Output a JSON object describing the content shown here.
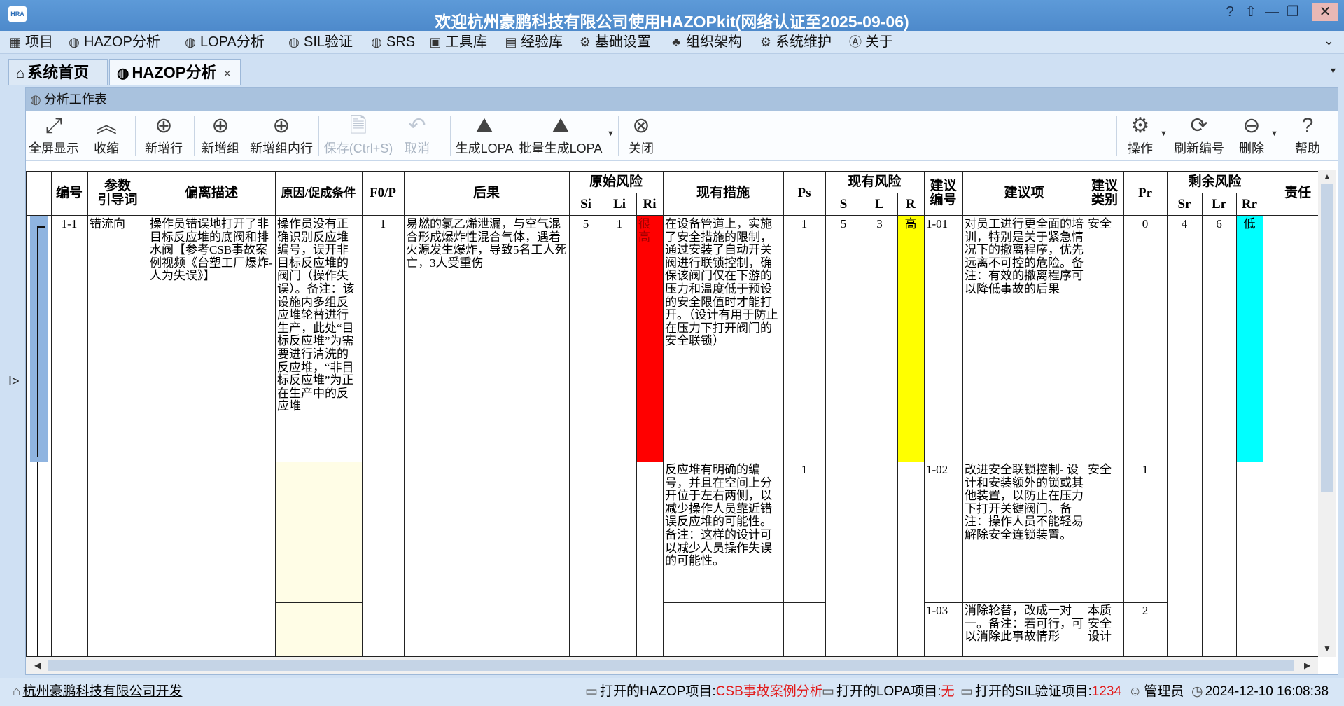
{
  "window": {
    "title": "欢迎杭州豪鹏科技有限公司使用HAZOPkit(网络认证至2025-09-06)",
    "logo_text": "HRA",
    "controls": [
      "?",
      "⇧",
      "—",
      "❐",
      "✕"
    ]
  },
  "menu": [
    {
      "icon": "grid-icon",
      "label": "项目"
    },
    {
      "icon": "hazop-icon",
      "label": "HAZOP分析"
    },
    {
      "icon": "lopa-icon",
      "label": "LOPA分析"
    },
    {
      "icon": "sil-icon",
      "label": "SIL验证"
    },
    {
      "icon": "srs-icon",
      "label": "SRS"
    },
    {
      "icon": "toolbox-icon",
      "label": "工具库"
    },
    {
      "icon": "library-icon",
      "label": "经验库"
    },
    {
      "icon": "gear-icon",
      "label": "基础设置"
    },
    {
      "icon": "org-icon",
      "label": "组织架构"
    },
    {
      "icon": "maintenance-icon",
      "label": "系统维护"
    },
    {
      "icon": "about-icon",
      "label": "关于"
    }
  ],
  "tabs": [
    {
      "label": "系统首页",
      "active": false
    },
    {
      "label": "HAZOP分析",
      "active": true,
      "close": "×"
    }
  ],
  "panel": {
    "title": "分析工作表"
  },
  "toolbar": [
    {
      "icon": "fullscreen-icon",
      "glyph": "⤢",
      "label": "全屏显示"
    },
    {
      "icon": "collapse-icon",
      "glyph": "︽",
      "label": "收缩"
    },
    {
      "icon": "add-row-icon",
      "glyph": "⊕",
      "label": "新增行"
    },
    {
      "icon": "add-group-icon",
      "glyph": "⊕",
      "label": "新增组"
    },
    {
      "icon": "add-group-row-icon",
      "glyph": "⊕",
      "label": "新增组内行"
    },
    {
      "icon": "save-icon",
      "glyph": "🗎",
      "label": "保存(Ctrl+S)",
      "disabled": true
    },
    {
      "icon": "cancel-icon",
      "glyph": "↶",
      "label": "取消",
      "disabled": true
    },
    {
      "icon": "generate-lopa-icon",
      "glyph": "⛰",
      "label": "生成LOPA"
    },
    {
      "icon": "batch-lopa-icon",
      "glyph": "⛰",
      "label": "批量生成LOPA"
    },
    {
      "icon": "close-circle-icon",
      "glyph": "⊗",
      "label": "关闭"
    },
    {
      "icon": "operate-gear-icon",
      "glyph": "⚙",
      "label": "操作"
    },
    {
      "icon": "refresh-icon",
      "glyph": "⟳",
      "label": "刷新编号"
    },
    {
      "icon": "delete-icon",
      "glyph": "⊖",
      "label": "删除"
    },
    {
      "icon": "help-icon",
      "glyph": "?",
      "label": "帮助"
    }
  ],
  "table": {
    "headers": {
      "no": "编号",
      "param": "参数\n引导词",
      "deviation": "偏离描述",
      "cause": "原因/促成条件",
      "fp": "F0/P",
      "consequence": "后果",
      "orig_risk": "原始风险",
      "si": "Si",
      "li": "Li",
      "ri": "Ri",
      "measures": "现有措施",
      "ps": "Ps",
      "cur_risk": "现有风险",
      "s": "S",
      "l": "L",
      "r": "R",
      "sug_no": "建议\n编号",
      "suggestion": "建议项",
      "sug_type": "建议\n类别",
      "pr": "Pr",
      "res_risk": "剩余风险",
      "sr": "Sr",
      "lr": "Lr",
      "rr": "Rr",
      "owner": "责任"
    },
    "row": {
      "no": "1-1",
      "param": "错流向",
      "deviation": "操作员错误地打开了非目标反应堆的底阀和排水阀【参考CSB事故案例视频《台塑工厂爆炸-人为失误》】",
      "cause": "操作员没有正确识别反应堆编号，误开非目标反应堆的阀门（操作失误）。备注：该设施内多组反应堆轮替进行生产，此处“目标反应堆”为需要进行清洗的反应堆，“非目标反应堆”为正在生产中的反应堆",
      "fp": "1",
      "consequence": "易燃的氯乙烯泄漏，与空气混合形成爆炸性混合气体，遇着火源发生爆炸，导致5名工人死亡，3人受重伤",
      "si": "5",
      "li": "1",
      "ri": "很高",
      "s": "5",
      "l": "3",
      "r": "高",
      "sr": "4",
      "lr": "6",
      "rr": "低"
    },
    "measures": [
      {
        "text": "在设备管道上，实施了安全措施的限制，通过安装了自动开关阀进行联锁控制，确保该阀门仅在下游的压力和温度低于预设的安全限值时才能打开。（设计有用于防止在压力下打开阀门的安全联锁）",
        "ps": "1"
      },
      {
        "text": "反应堆有明确的编号，并且在空间上分开位于左右两侧，以减少操作人员靠近错误反应堆的可能性。备注：这样的设计可以减少人员操作失误的可能性。",
        "ps": "1"
      }
    ],
    "suggestions": [
      {
        "no": "1-01",
        "text": "对员工进行更全面的培训，特别是关于紧急情况下的撤离程序，优先远离不可控的危险。备注：有效的撤离程序可以降低事故的后果",
        "type": "安全",
        "pr": "0"
      },
      {
        "no": "1-02",
        "text": "改进安全联锁控制- 设计和安装额外的锁或其他装置，以防止在压力下打开关键阀门。备注：操作人员不能轻易解除安全连锁装置。",
        "type": "安全",
        "pr": "1"
      },
      {
        "no": "1-03",
        "text": "消除轮替，改成一对一。备注：若可行，可以消除此事故情形",
        "type": "本质安全设计",
        "pr": "2"
      }
    ],
    "colors": {
      "very_high": "#ff0000",
      "high": "#ffff00",
      "low": "#00ffff",
      "empty_cause": "#fffde6"
    }
  },
  "side_toggle": "I>",
  "status": {
    "company": "杭州豪鹏科技有限公司开发",
    "hazop_label": "打开的HAZOP项目:",
    "hazop_value": "CSB事故案例分析",
    "lopa_label": "打开的LOPA项目:",
    "lopa_value": "无",
    "sil_label": "打开的SIL验证项目:",
    "sil_value": "1234",
    "user": "管理员",
    "datetime": "2024-12-10 16:08:38"
  }
}
